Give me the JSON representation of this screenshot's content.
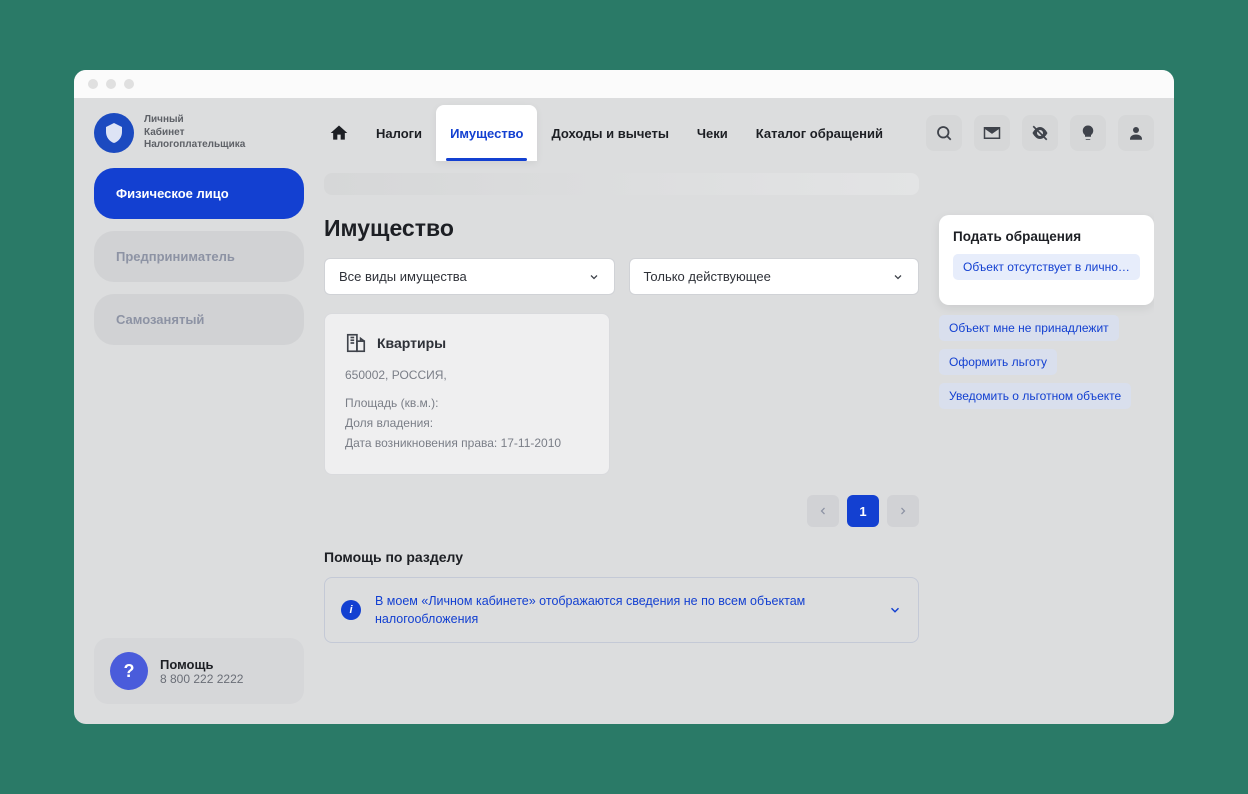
{
  "logo": {
    "line1": "Личный",
    "line2": "Кабинет",
    "line3": "Налогоплательщика"
  },
  "nav": {
    "taxes": "Налоги",
    "property": "Имущество",
    "income": "Доходы и вычеты",
    "receipts": "Чеки",
    "catalog": "Каталог обращений"
  },
  "roles": {
    "individual": "Физическое лицо",
    "entrepreneur": "Предприниматель",
    "selfemployed": "Самозанятый"
  },
  "help": {
    "title": "Помощь",
    "phone": "8 800 222 2222"
  },
  "page": {
    "title": "Имущество"
  },
  "filters": {
    "type": "Все виды имущества",
    "status": "Только действующее"
  },
  "property": {
    "title": "Квартиры",
    "address": "650002, РОССИЯ,",
    "area_label": "Площадь (кв.м.):",
    "share_label": "Доля владения:",
    "date_label": "Дата возникновения права: 17-11-2010"
  },
  "pagination": {
    "current": "1"
  },
  "help_section": {
    "title": "Помощь по разделу",
    "text": "В моем «Личном кабинете» отображаются сведения не по всем объектам налогообложения"
  },
  "appeals": {
    "title": "Подать обращения",
    "link1": "Объект отсутствует в личном ...",
    "link2": "Объект мне не принадлежит",
    "link3": "Оформить льготу",
    "link4": "Уведомить о льготном объекте"
  }
}
